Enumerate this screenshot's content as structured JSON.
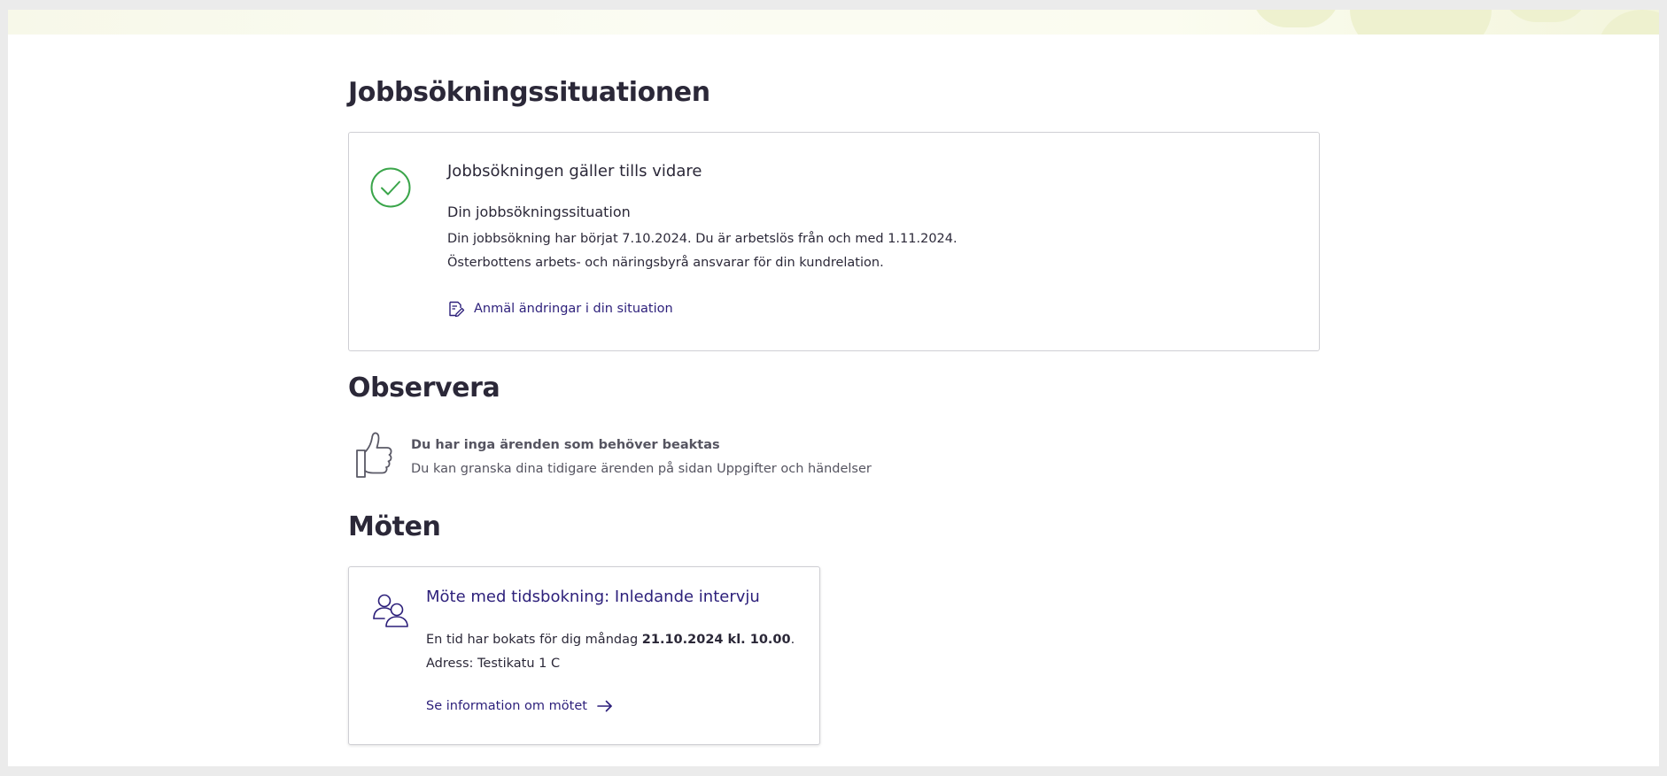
{
  "status_section": {
    "title": "Jobbsökningssituationen",
    "heading": "Jobbsökningen gäller tills vidare",
    "subheading": "Din jobbsökningssituation",
    "line1": "Din jobbsökning har börjat 7.10.2024. Du är arbetslös från och med 1.11.2024.",
    "line2": "Österbottens arbets- och näringsbyrå ansvarar för din kundrelation.",
    "change_link": "Anmäl ändringar i din situation",
    "status_icon": "check-circle-icon",
    "status_color": "#3aa54a"
  },
  "observe_section": {
    "title": "Observera",
    "icon": "thumbs-up-icon",
    "message_title": "Du har inga ärenden som behöver beaktas",
    "message_text": "Du kan granska dina tidigare ärenden på sidan Uppgifter och händelser"
  },
  "meetings_section": {
    "title": "Möten",
    "meeting": {
      "title": "Möte med tidsbokning: Inledande intervju",
      "booked_prefix": "En tid har bokats för dig måndag ",
      "booked_time": "21.10.2024 kl. 10.00",
      "booked_suffix": ".",
      "address": "Adress: Testikatu 1 C",
      "details_link": "Se information om mötet",
      "icon": "people-icon"
    }
  },
  "colors": {
    "link": "#2c1f7a",
    "text": "#2b2838",
    "muted": "#555460",
    "banner": "#f7f8e9"
  }
}
